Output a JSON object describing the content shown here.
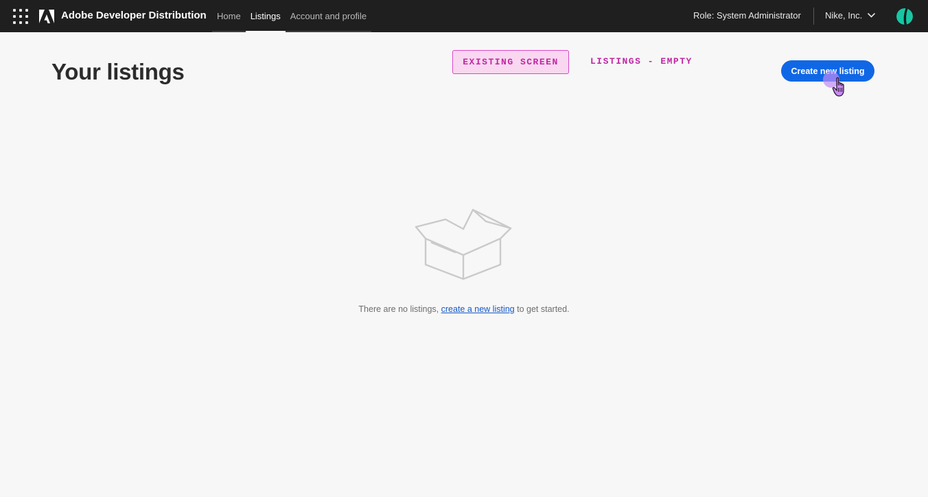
{
  "header": {
    "brand": "Adobe Developer Distribution",
    "apps_icon": "apps-grid-icon",
    "logo_icon": "adobe-logo-icon",
    "nav": [
      {
        "label": "Home",
        "active": false
      },
      {
        "label": "Listings",
        "active": true
      },
      {
        "label": "Account and profile",
        "active": false
      }
    ],
    "role": "Role: System Administrator",
    "org": "Nike, Inc.",
    "org_icon": "chevron-down-icon",
    "avatar_icon": "avatar-icon"
  },
  "main": {
    "title": "Your listings",
    "create_button": "Create new listing"
  },
  "annotations": {
    "existing_screen": "EXISTING SCREEN",
    "listings_empty": "LISTINGS - EMPTY"
  },
  "empty_state": {
    "icon": "empty-box-icon",
    "text_before": "There are no listings, ",
    "link_text": "create a new listing",
    "text_after": " to get started."
  },
  "colors": {
    "topbar": "#1f1f1f",
    "accent": "#1067e6",
    "annotation": "#c026a3",
    "avatar": "#17c7a3"
  }
}
